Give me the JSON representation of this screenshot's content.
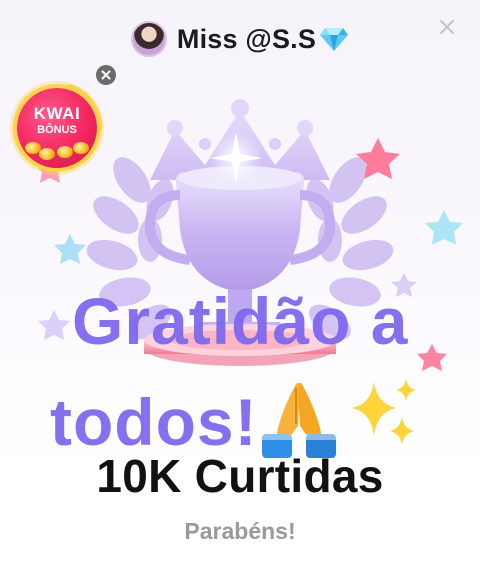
{
  "header": {
    "profile_name": "Miss @S.S",
    "gem_icon": "diamond-icon",
    "close_icon": "close-icon"
  },
  "bonus": {
    "title": "KWAI",
    "subtitle": "BÔNUS",
    "close_icon": "close-icon"
  },
  "card": {
    "line1": "Gratidão a",
    "line2": "todos!",
    "headline": "10K Curtidas",
    "subtext": "Parabéns!"
  },
  "colors": {
    "accent_text": "#7b66ee",
    "headline": "#121212",
    "muted": "#9a9a9a",
    "bonus_red": "#f1265f",
    "bonus_gold": "#ffd24a"
  }
}
